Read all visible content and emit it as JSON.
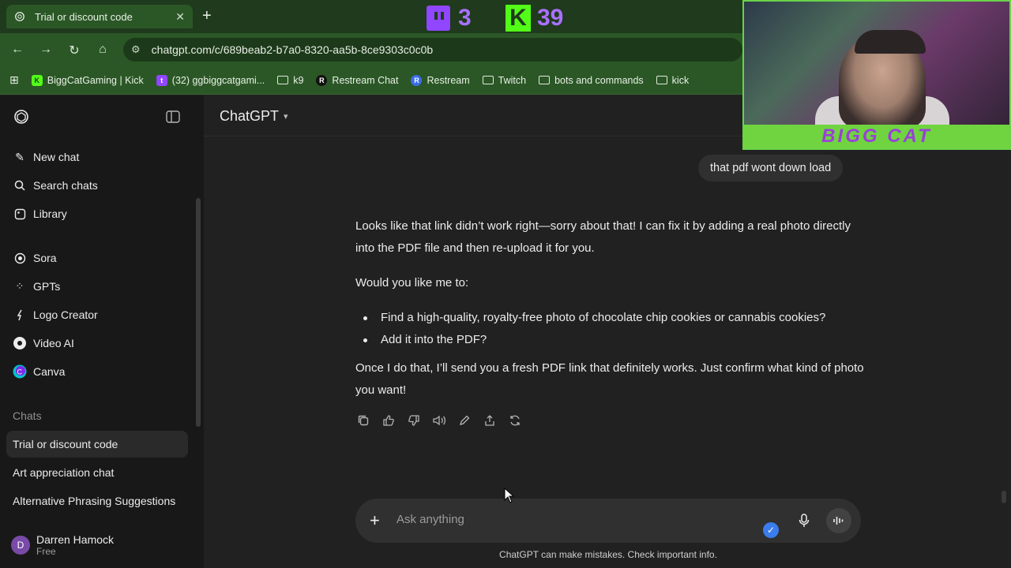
{
  "browser": {
    "tab_title": "Trial or discount code",
    "url": "chatgpt.com/c/689beab2-b7a0-8320-aa5b-8ce9303c0c0b",
    "bookmarks": [
      {
        "label": "BiggCatGaming | Kick",
        "icon": "kick-icon"
      },
      {
        "label": "(32) ggbiggcatgami...",
        "icon": "twitch-icon"
      },
      {
        "label": "k9",
        "icon": "folder-icon"
      },
      {
        "label": "Restream Chat",
        "icon": "restream-icon"
      },
      {
        "label": "Restream",
        "icon": "restream-blue-icon"
      },
      {
        "label": "Twitch",
        "icon": "folder-icon"
      },
      {
        "label": "bots and commands",
        "icon": "folder-icon"
      },
      {
        "label": "kick",
        "icon": "folder-icon"
      }
    ]
  },
  "overlay": {
    "twitch_count": "3",
    "kick_count": "39",
    "webcam_banner": "BIGG CAT"
  },
  "sidebar": {
    "items": [
      {
        "label": "New chat",
        "icon": "edit-icon"
      },
      {
        "label": "Search chats",
        "icon": "search-icon"
      },
      {
        "label": "Library",
        "icon": "library-icon"
      },
      {
        "label": "Sora",
        "icon": "sora-icon"
      },
      {
        "label": "GPTs",
        "icon": "gpts-icon"
      },
      {
        "label": "Logo Creator",
        "icon": "logo-creator-icon"
      },
      {
        "label": "Video AI",
        "icon": "video-ai-icon"
      },
      {
        "label": "Canva",
        "icon": "canva-icon"
      }
    ],
    "chats_label": "Chats",
    "chats": [
      {
        "label": "Trial or discount code",
        "active": true
      },
      {
        "label": "Art appreciation chat",
        "active": false
      },
      {
        "label": "Alternative Phrasing Suggestions",
        "active": false
      }
    ],
    "user": {
      "initial": "D",
      "name": "Darren Hamock",
      "plan": "Free"
    }
  },
  "main": {
    "model_name": "ChatGPT",
    "user_message": "that pdf wont down load",
    "reply": {
      "p1": "Looks like that link didn’t work right—sorry about that! I can fix it by adding a real photo directly into the PDF file and then re-upload it for you.",
      "p2": "Would you like me to:",
      "bullets": [
        "Find a high-quality, royalty-free photo of chocolate chip cookies or cannabis cookies?",
        "Add it into the PDF?"
      ],
      "p3": "Once I do that, I’ll send you a fresh PDF link that definitely works. Just confirm what kind of photo you want!"
    },
    "composer_placeholder": "Ask anything",
    "disclaimer": "ChatGPT can make mistakes. Check important info."
  },
  "colors": {
    "tab_strip": "#1f3a1c",
    "toolbar": "#2b5726",
    "app_bg": "#212121",
    "sidebar_bg": "#181818",
    "accent_purple": "#a970ff",
    "kick_green": "#53fc18"
  }
}
